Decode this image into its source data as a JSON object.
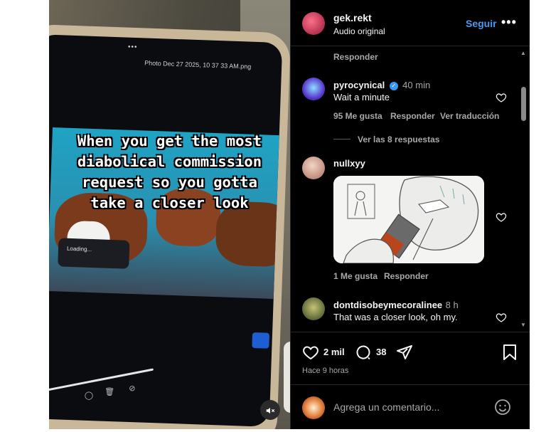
{
  "video": {
    "photo_title": "Photo Dec 27 2025, 10 37 33 AM.png",
    "meme_line1": "When you get the most",
    "meme_line2": "diabolical commission",
    "meme_line3": "request so you gotta",
    "meme_line4": "take a closer look",
    "loading_text": "Loading...",
    "mute_icon": "muted-speaker-icon"
  },
  "header": {
    "username": "gek.rekt",
    "subtitle": "Audio original",
    "follow_label": "Seguir",
    "more_label": "•••"
  },
  "comments": {
    "top_reply_label": "Responder",
    "items": [
      {
        "username": "pyrocynical",
        "verified": true,
        "time": "40 min",
        "text": "Wait a minute",
        "likes": "95 Me gusta",
        "reply_label": "Responder",
        "translate_label": "Ver traducción",
        "replies_label": "Ver las 8 respuestas"
      },
      {
        "username": "nullxyy",
        "time": "",
        "text": "",
        "likes": "1 Me gusta",
        "reply_label": "Responder"
      },
      {
        "username": "dontdisobeymecoralinee",
        "time": "8 h",
        "text": "That was a closer look, oh my."
      }
    ]
  },
  "actions": {
    "likes_count": "2 mil",
    "comments_count": "38",
    "time_ago": "Hace 9 horas"
  },
  "add_comment": {
    "placeholder": "Agrega un comentario..."
  },
  "colors": {
    "background": "#000000",
    "accent_blue": "#4a9bf2",
    "muted_text": "#a8a8a8",
    "primary_text": "#f5f5f5"
  }
}
